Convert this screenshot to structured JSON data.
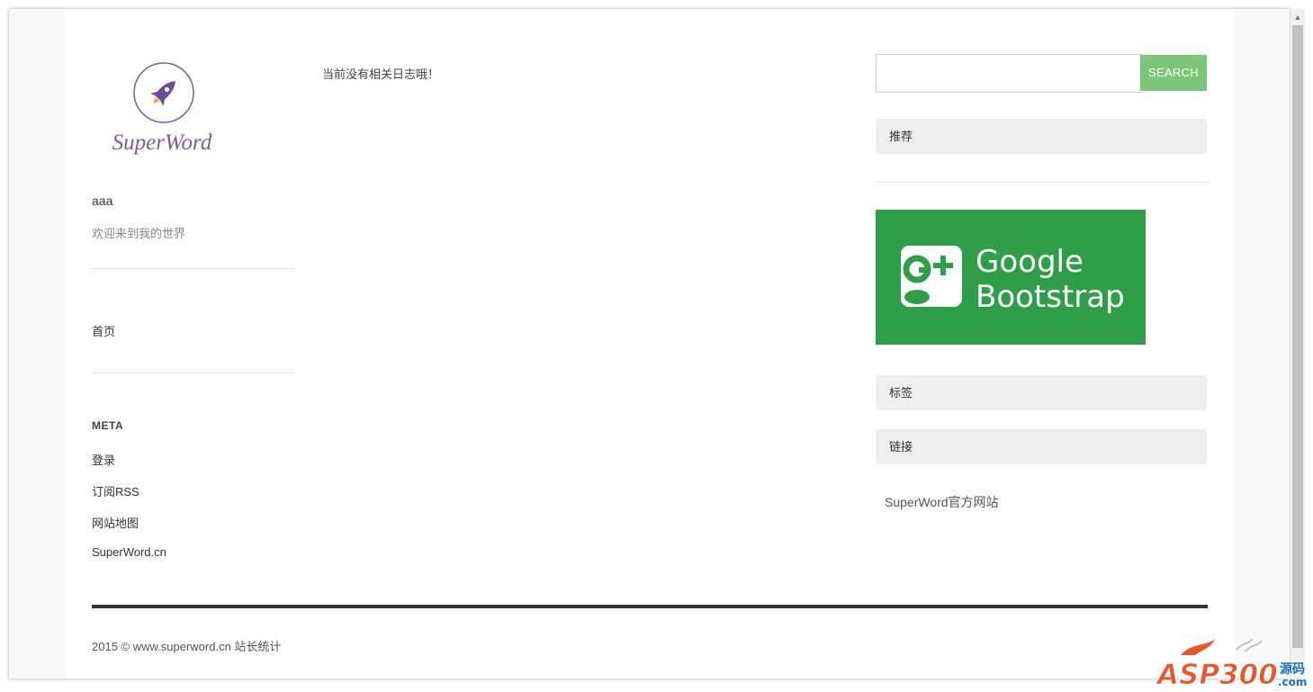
{
  "brand": {
    "logo_text": "SuperWord"
  },
  "sidebar_left": {
    "site_title": "aaa",
    "site_description": "欢迎来到我的世界",
    "nav": [
      {
        "label": "首页"
      }
    ],
    "meta": {
      "heading": "META",
      "links": [
        {
          "label": "登录"
        },
        {
          "label": "订阅RSS"
        },
        {
          "label": "网站地图"
        },
        {
          "label": "SuperWord.cn"
        }
      ]
    }
  },
  "main": {
    "empty_message": "当前没有相关日志哦！"
  },
  "sidebar_right": {
    "search": {
      "button_label": "SEARCH",
      "value": "",
      "placeholder": ""
    },
    "widgets": {
      "recommend": "推荐",
      "tags": "标签",
      "links": "链接"
    },
    "banner": {
      "line1": "Google",
      "line2": "Bootstrap"
    },
    "link_items": [
      {
        "label": "SuperWord官方网站"
      }
    ]
  },
  "footer": {
    "copyright": "2015 © www.superword.cn 站长统计"
  },
  "watermark": {
    "text": "ASP300",
    "suffix_top": "源码",
    "suffix_bottom": ".com"
  },
  "colors": {
    "accent_green": "#7cc67a",
    "banner_green": "#2f9e48",
    "logo_purple": "#7a5c9e",
    "footer_rule": "#333333",
    "widget_bg": "#eeeeee"
  },
  "icons": [
    "rocket-icon",
    "google-plus-icon",
    "scroll-up-arrow-icon"
  ]
}
